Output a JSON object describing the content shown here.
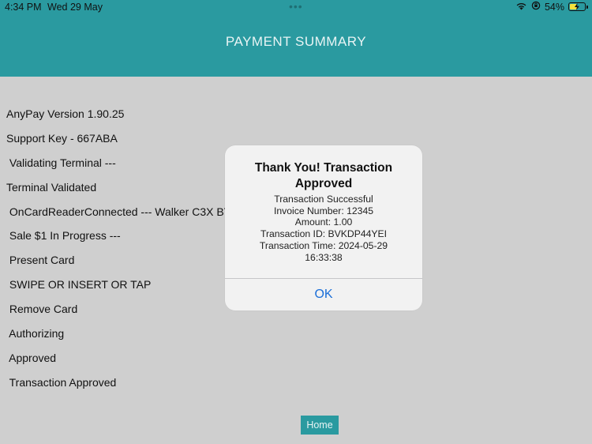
{
  "status_bar": {
    "time": "4:34 PM",
    "date": "Wed 29 May",
    "dots": "•••",
    "battery_text": "54%",
    "battery_level": 0.54,
    "wifi_icon": "wifi-icon",
    "orientation_lock_icon": "orientation-lock-icon",
    "battery_icon": "battery-charging-icon"
  },
  "header": {
    "title": "PAYMENT SUMMARY",
    "color": "#2a9aa0"
  },
  "log": [
    "AnyPay Version 1.90.25",
    "Support Key - 667ABA",
    " Validating Terminal ---",
    "Terminal Validated",
    " OnCardReaderConnected --- Walker C3X BT",
    " Sale $1 In Progress ---",
    " Present Card",
    " SWIPE OR INSERT OR TAP",
    " Remove Card",
    " Authorizing",
    " Approved",
    " Transaction Approved"
  ],
  "alert": {
    "title": "Thank You! Transaction Approved",
    "message": "Transaction Successful\nInvoice Number: 12345\nAmount: 1.00\nTransaction ID: BVKDP44YEI\nTransaction Time: 2024-05-29\n16:33:38",
    "ok_label": "OK"
  },
  "home_button": {
    "label": "Home"
  }
}
